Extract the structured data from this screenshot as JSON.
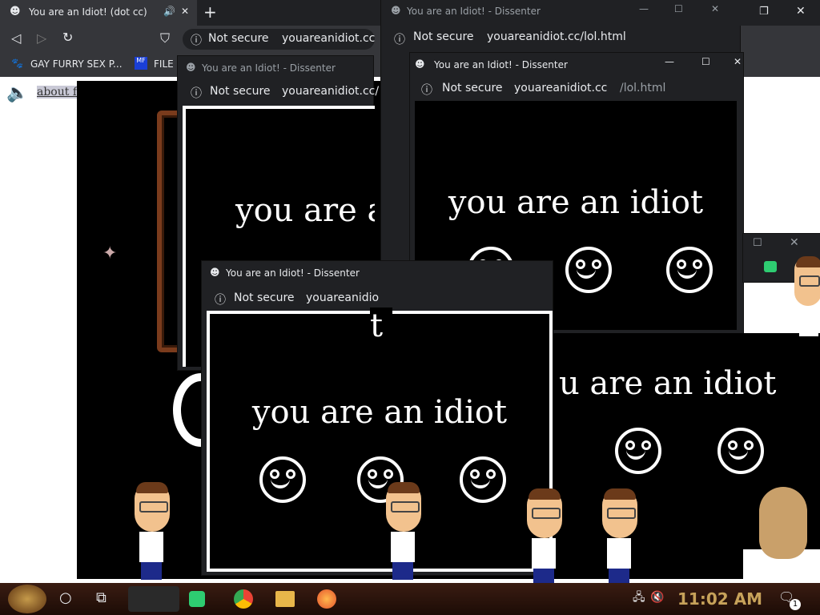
{
  "browser": {
    "tab_title": "You are an Idiot! (dot cc)",
    "new_tab": "+",
    "close": "✕",
    "address_security": "Not secure",
    "address_domain": "youareanidiot.cc",
    "bookmarks": [
      "GAY FURRY SEX P...",
      "FILE"
    ],
    "flash_link": "about flash"
  },
  "popups": [
    {
      "title": "You are an Idiot! - Dissenter",
      "security": "Not secure",
      "domain": "youareanidiot.cc/lol.html",
      "path": ""
    },
    {
      "title": "You are an Idiot! - Dissenter",
      "security": "Not secure",
      "domain": "youareanidiot.cc/",
      "path": ""
    },
    {
      "title": "You are an Idiot! - Dissenter",
      "security": "Not secure",
      "domain": "youareanidiot.cc",
      "path": "/lol.html"
    },
    {
      "title": "You are an Idiot! - Dissenter",
      "security": "Not secure",
      "domain": "youareanidio",
      "path": ""
    }
  ],
  "message": "you are an idiot",
  "message_partial_a": "you are a",
  "message_partial_b": "u are an idiot",
  "message_partial_c": "t",
  "taskbar": {
    "clock": "11:02 AM",
    "notification_count": "1"
  },
  "colors": {
    "chrome_dark": "#202124",
    "chrome_mid": "#35363a",
    "steampunk_brown": "#7a3b1c"
  }
}
